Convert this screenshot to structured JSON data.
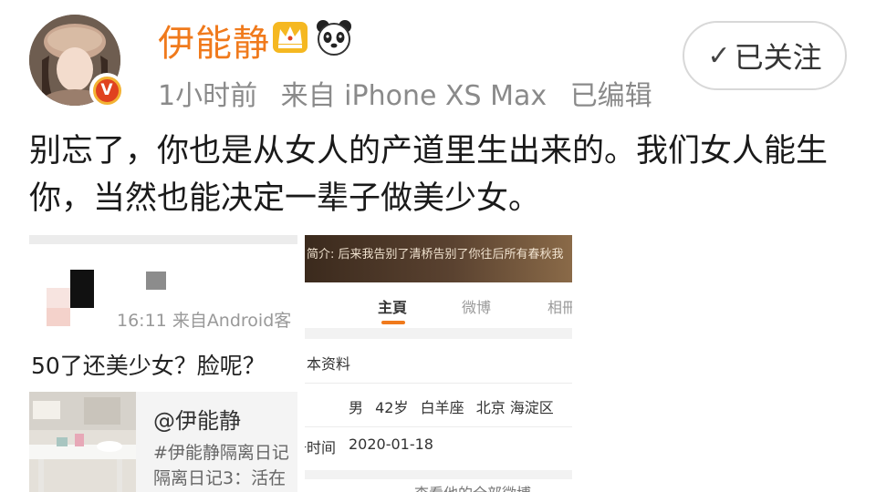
{
  "user": {
    "name": "伊能静",
    "badge_verified": "V",
    "icons": [
      "crown-icon",
      "panda-icon"
    ]
  },
  "post_meta": {
    "time": "1小时前",
    "source": "来自 iPhone XS Max",
    "edited": "已编辑"
  },
  "follow_button": {
    "label": "已关注",
    "icon": "check-icon"
  },
  "post": {
    "line1": "别忘了，你也是从女人的产道里生出来的。我们女人能生",
    "line2": "你，当然也能决定一辈子做美少女。"
  },
  "embedded_left": {
    "timestamp": "16:11",
    "source": "来自Android客",
    "comment": "50了还美少女？脸呢？",
    "card": {
      "title": "@伊能静",
      "line1": "#伊能静隔离日记",
      "line2": "隔离日记3：活在"
    }
  },
  "embedded_right": {
    "banner_intro": "简介: 后来我告别了清桥告别了你往后所有春秋我",
    "tabs": [
      "主頁",
      "微博",
      "相冊"
    ],
    "section_title": "本资料",
    "info": [
      "男",
      "42岁",
      "白羊座",
      "北京 海淀区"
    ],
    "reg_label": "注册时间",
    "reg_date": "2020-01-18",
    "view_all": "查看他的全部微博"
  },
  "colors": {
    "username": "#f07a1c",
    "meta_gray": "#8a8a8a",
    "tab_accent": "#f07a1c",
    "verified_red": "#e0421f"
  }
}
